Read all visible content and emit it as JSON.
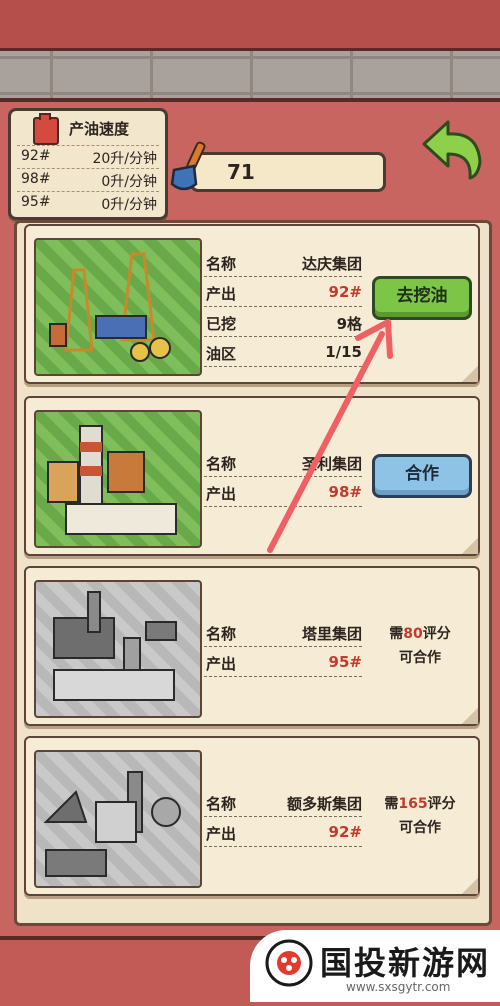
{
  "speed_panel": {
    "title": "产油速度",
    "rows": [
      {
        "grade": "92#",
        "value": "20升/分钟"
      },
      {
        "grade": "98#",
        "value": "0升/分钟"
      },
      {
        "grade": "95#",
        "value": "0升/分钟"
      }
    ]
  },
  "shovel_count": "71",
  "cards": [
    {
      "name_label": "名称",
      "name": "达庆集团",
      "output_label": "产出",
      "output": "92#",
      "dug_label": "已挖",
      "dug": "9格",
      "field_label": "油区",
      "field": "1/15",
      "button": "去挖油"
    },
    {
      "name_label": "名称",
      "name": "圣利集团",
      "output_label": "产出",
      "output": "98#",
      "button": "合作"
    },
    {
      "name_label": "名称",
      "name": "塔里集团",
      "output_label": "产出",
      "output": "95#",
      "need_prefix": "需",
      "need_score": "80",
      "need_suffix": "评分",
      "need_line2": "可合作"
    },
    {
      "name_label": "名称",
      "name": "额多斯集团",
      "output_label": "产出",
      "output": "92#",
      "need_prefix": "需",
      "need_score": "165",
      "need_suffix": "评分",
      "need_line2": "可合作"
    }
  ],
  "watermark": {
    "title": "国投新游网",
    "url": "www.sxsgytr.com"
  },
  "colors": {
    "frame_red": "#c96560",
    "green_button": "#7cc546",
    "blue_button": "#8fc3e6",
    "highlight_red": "#c23a2e",
    "arrow_pink": "#ef5f63"
  }
}
